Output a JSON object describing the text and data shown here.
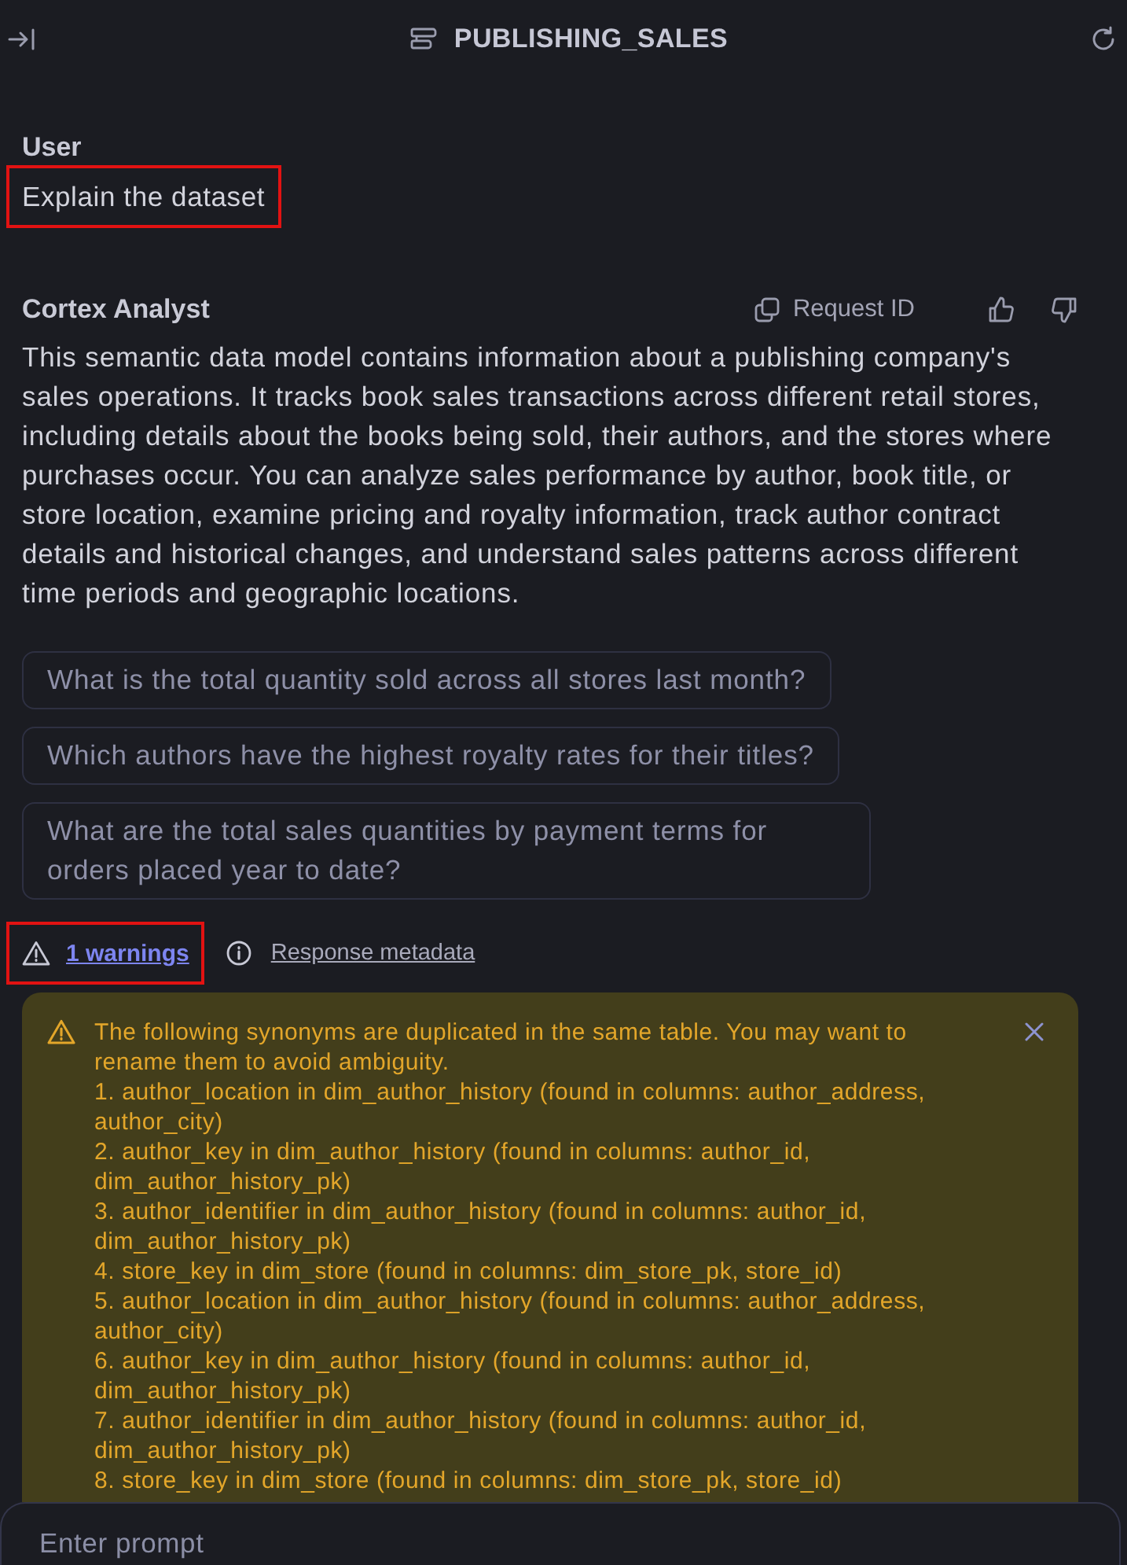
{
  "header": {
    "title": "PUBLISHING_SALES"
  },
  "messages": [
    {
      "kind": "user",
      "author": "User",
      "text": "Explain the dataset",
      "highlighted": true
    },
    {
      "kind": "assistant",
      "author": "Cortex Analyst",
      "request_id_label": "Request ID",
      "text": "This semantic data model contains information about a publishing company's sales operations. It tracks book sales transactions across different retail stores, including details about the books being sold, their authors, and the stores where purchases occur. You can analyze sales performance by author, book title, or store location, examine pricing and royalty information, track author contract details and historical changes, and understand sales patterns across different time periods and geographic locations.",
      "suggestions": [
        "What is the total quantity sold across all stores last month?",
        "Which authors have the highest royalty rates for their titles?",
        "What are the total sales quantities by payment terms for orders placed year to date?"
      ],
      "warnings_link": {
        "label": "1 warnings",
        "highlighted": true
      },
      "metadata_link": "Response metadata",
      "warning": {
        "intro": "The following synonyms are duplicated in the same table. You may want to rename them to avoid ambiguity.",
        "items": [
          "1. author_location in dim_author_history (found in columns: author_address, author_city)",
          "2. author_key in dim_author_history (found in columns: author_id, dim_author_history_pk)",
          "3. author_identifier in dim_author_history (found in columns: author_id, dim_author_history_pk)",
          "4. store_key in dim_store (found in columns: dim_store_pk, store_id)",
          "5. author_location in dim_author_history (found in columns: author_address, author_city)",
          "6. author_key in dim_author_history (found in columns: author_id, dim_author_history_pk)",
          "7. author_identifier in dim_author_history (found in columns: author_id, dim_author_history_pk)",
          "8. store_key in dim_store (found in columns: dim_store_pk, store_id)"
        ]
      }
    }
  ],
  "prompt": {
    "placeholder": "Enter prompt"
  }
}
